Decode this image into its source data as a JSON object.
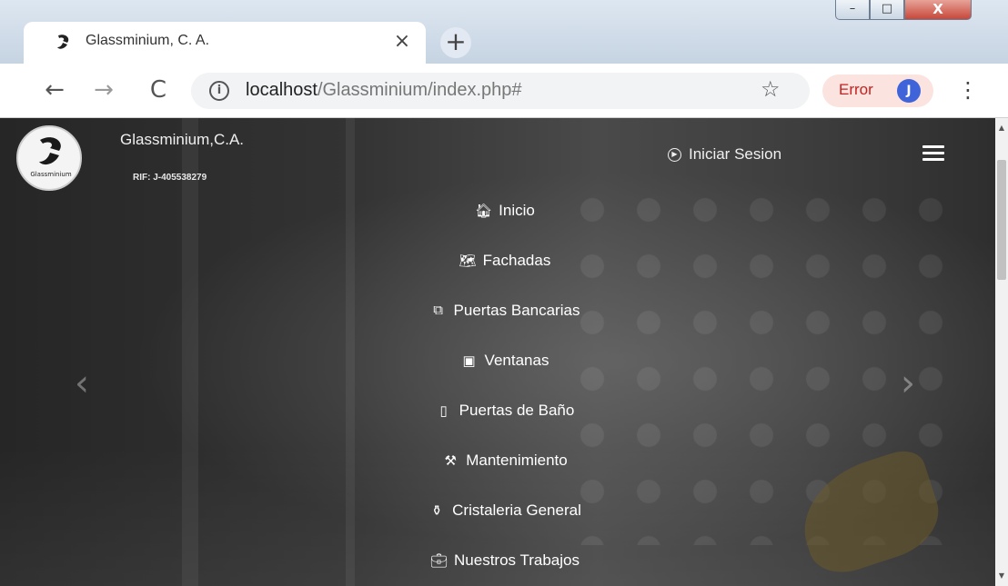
{
  "browser": {
    "tab_title": "Glassminium, C. A.",
    "tab_close": "×",
    "new_tab": "+",
    "url_host": "localhost",
    "url_path": "/Glassminium/index.php#",
    "info_glyph": "i",
    "star_glyph": "☆",
    "error_label": "Error",
    "profile_initial": "J",
    "kebab_glyph": "⋮",
    "back_glyph": "←",
    "forward_glyph": "→",
    "reload_glyph": "C",
    "window": {
      "minimize": "–",
      "maximize": "□",
      "close": "X"
    },
    "colors": {
      "error_bg": "#fbe3e0",
      "error_text": "#c5221f",
      "avatar_bg": "#3f63d8"
    }
  },
  "site": {
    "logo_text": "Glassminium",
    "brand": "Glassminium,C.A.",
    "rif": "RIF: J-405538279",
    "login_label": "Iniciar Sesion",
    "login_icon": "login-icon",
    "carousel_prev": "‹",
    "carousel_next": "›",
    "menu": [
      {
        "label": "Inicio",
        "icon": "home-icon",
        "glyph": "🏠︎"
      },
      {
        "label": "Fachadas",
        "icon": "map-icon",
        "glyph": "🗺︎"
      },
      {
        "label": "Puertas Bancarias",
        "icon": "copy-icon",
        "glyph": "⧉"
      },
      {
        "label": "Ventanas",
        "icon": "window-icon",
        "glyph": "▣"
      },
      {
        "label": "Puertas de Baño",
        "icon": "door-icon",
        "glyph": "▯"
      },
      {
        "label": "Mantenimiento",
        "icon": "tools-icon",
        "glyph": "⚒"
      },
      {
        "label": "Cristaleria General",
        "icon": "glass-icon",
        "glyph": "⚱"
      },
      {
        "label": "Nuestros Trabajos",
        "icon": "briefcase-icon",
        "glyph": "💼︎"
      }
    ]
  }
}
